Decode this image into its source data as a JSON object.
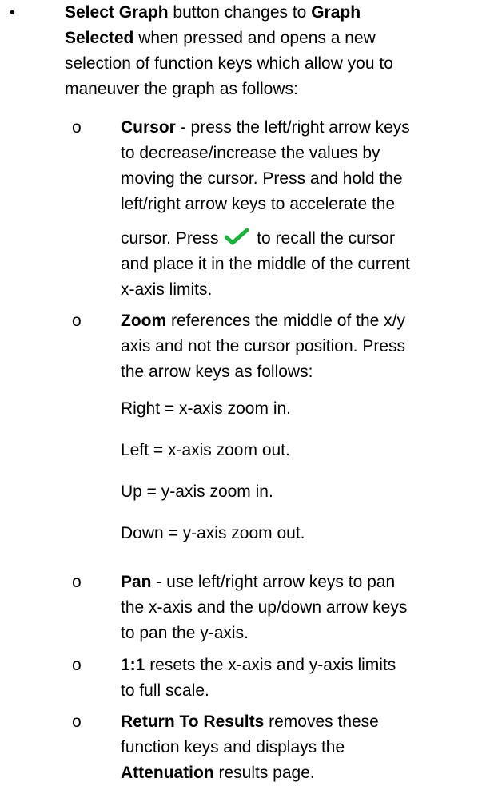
{
  "main": {
    "bullet": "•",
    "label_bold_1": "Select Graph",
    "text_1": " button changes to ",
    "label_bold_2": "Graph",
    "label_bold_2b": "Selected",
    "text_2": " when pressed and opens a new",
    "text_3": "selection of function keys which allow you to",
    "text_4": "maneuver the graph as follows:"
  },
  "sub_marker": "o",
  "cursor": {
    "term": "Cursor",
    "l1": " - press the left/right arrow keys",
    "l2": "to decrease/increase the values by",
    "l3": "moving the cursor. Press and hold the",
    "l4": "left/right arrow keys to accelerate the",
    "l5a": "cursor. Press ",
    "l5b": " to recall the cursor",
    "l6": "and place it in the middle of the current",
    "l7": "x-axis limits.",
    "check_icon": "check-icon",
    "check_color": "#19b23a"
  },
  "zoom": {
    "term": "Zoom",
    "l1": " references the middle of the x/y",
    "l2": "axis and not the cursor position. Press",
    "l3": "the arrow keys as follows:",
    "right": "Right = x-axis zoom in.",
    "left": "Left = x-axis zoom out.",
    "up": "Up = y-axis zoom in.",
    "down": "Down = y-axis zoom out."
  },
  "pan": {
    "term": "Pan",
    "l1": " - use left/right arrow keys to pan",
    "l2": "the x-axis and the up/down arrow keys",
    "l3": "to pan the y-axis."
  },
  "one_to_one": {
    "term": "1:1",
    "l1": " resets the x-axis and y-axis limits",
    "l2": "to full scale."
  },
  "return_results": {
    "term": "Return To Results",
    "l1": " removes these",
    "l2": "function keys and displays the",
    "term2": "Attenuation",
    "l3": " results page."
  }
}
